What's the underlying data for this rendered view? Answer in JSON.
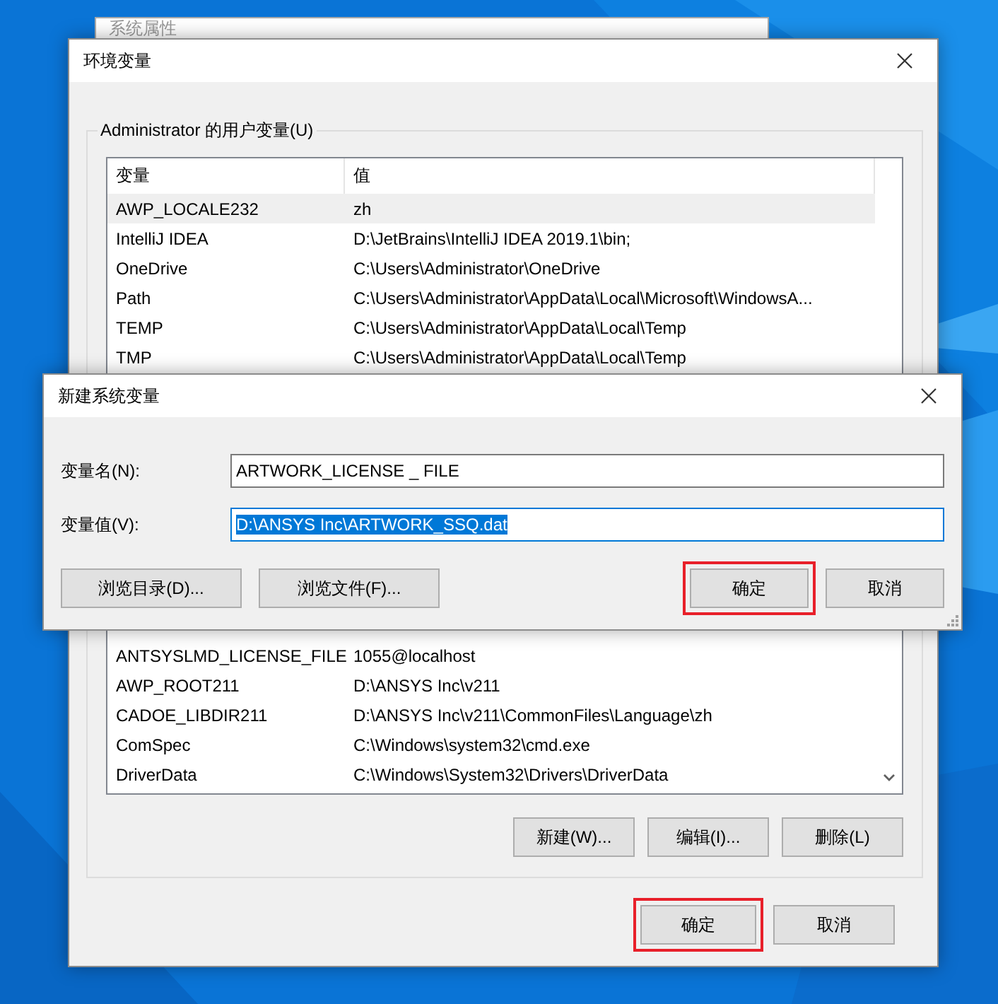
{
  "back_window": {
    "title": "系统属性"
  },
  "env_window": {
    "title": "环境变量",
    "group_label": "Administrator 的用户变量(U)",
    "columns": [
      "变量",
      "值"
    ],
    "user_rows": [
      {
        "name": "AWP_LOCALE232",
        "value": "zh",
        "selected": true
      },
      {
        "name": "IntelliJ IDEA",
        "value": "D:\\JetBrains\\IntelliJ IDEA 2019.1\\bin;",
        "selected": false
      },
      {
        "name": "OneDrive",
        "value": "C:\\Users\\Administrator\\OneDrive",
        "selected": false
      },
      {
        "name": "Path",
        "value": "C:\\Users\\Administrator\\AppData\\Local\\Microsoft\\WindowsA...",
        "selected": false
      },
      {
        "name": "TEMP",
        "value": "C:\\Users\\Administrator\\AppData\\Local\\Temp",
        "selected": false
      },
      {
        "name": "TMP",
        "value": "C:\\Users\\Administrator\\AppData\\Local\\Temp",
        "selected": false
      }
    ],
    "system_rows": [
      {
        "name": "ANTSYSLMD_LICENSE_FILE",
        "value": "1055@localhost",
        "selected": false
      },
      {
        "name": "AWP_ROOT211",
        "value": "D:\\ANSYS Inc\\v211",
        "selected": false
      },
      {
        "name": "CADOE_LIBDIR211",
        "value": "D:\\ANSYS Inc\\v211\\CommonFiles\\Language\\zh",
        "selected": false
      },
      {
        "name": "ComSpec",
        "value": "C:\\Windows\\system32\\cmd.exe",
        "selected": false
      },
      {
        "name": "DriverData",
        "value": "C:\\Windows\\System32\\Drivers\\DriverData",
        "selected": false
      }
    ],
    "list_buttons": [
      {
        "label": "新建(W)...",
        "highlighted": false
      },
      {
        "label": "编辑(I)...",
        "highlighted": false
      },
      {
        "label": "删除(L)",
        "highlighted": false
      }
    ],
    "footer_buttons": [
      {
        "label": "确定",
        "highlighted": true
      },
      {
        "label": "取消",
        "highlighted": false
      }
    ]
  },
  "new_dialog": {
    "title": "新建系统变量",
    "fields": [
      {
        "label": "变量名(N):",
        "value": "ARTWORK_LICENSE _ FILE",
        "text_selected": false
      },
      {
        "label": "变量值(V):",
        "value": "D:\\ANSYS Inc\\ARTWORK_SSQ.dat",
        "text_selected": true
      }
    ],
    "left_buttons": [
      {
        "label": "浏览目录(D)...",
        "highlighted": false
      },
      {
        "label": "浏览文件(F)...",
        "highlighted": false
      }
    ],
    "right_buttons": [
      {
        "label": "确定",
        "highlighted": true
      },
      {
        "label": "取消",
        "highlighted": false
      }
    ]
  }
}
